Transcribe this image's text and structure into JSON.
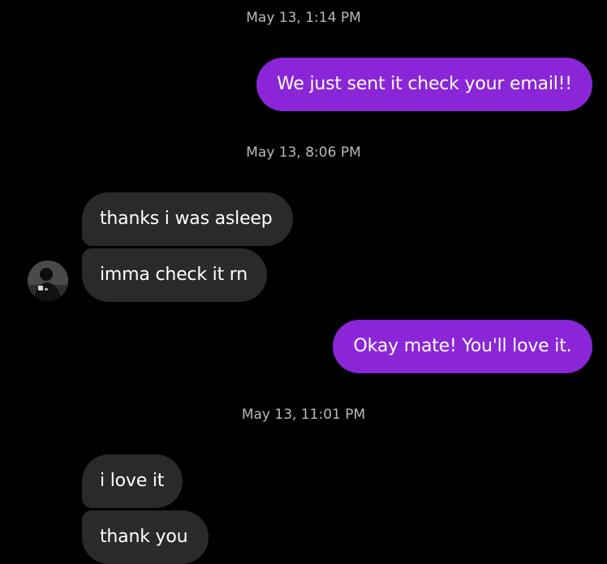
{
  "conversation": {
    "timestamps": [
      "May 13, 1:14 PM",
      "May 13, 8:06 PM",
      "May 13, 11:01 PM"
    ],
    "messages": [
      {
        "direction": "sent",
        "text": "We just sent it check your email!!"
      },
      {
        "direction": "received",
        "text": "thanks i was asleep"
      },
      {
        "direction": "received",
        "text": "imma check it rn"
      },
      {
        "direction": "sent",
        "text": "Okay mate! You'll love it."
      },
      {
        "direction": "received",
        "text": "i love it"
      },
      {
        "direction": "received",
        "text": "thank you"
      }
    ]
  },
  "theme": {
    "background": "#000000",
    "sent_bubble": "#8a26d8",
    "received_bubble": "#2a2a2c",
    "timestamp_text": "#b9b9b9"
  },
  "icons": {
    "contact_avatar": "contact-avatar-icon"
  }
}
